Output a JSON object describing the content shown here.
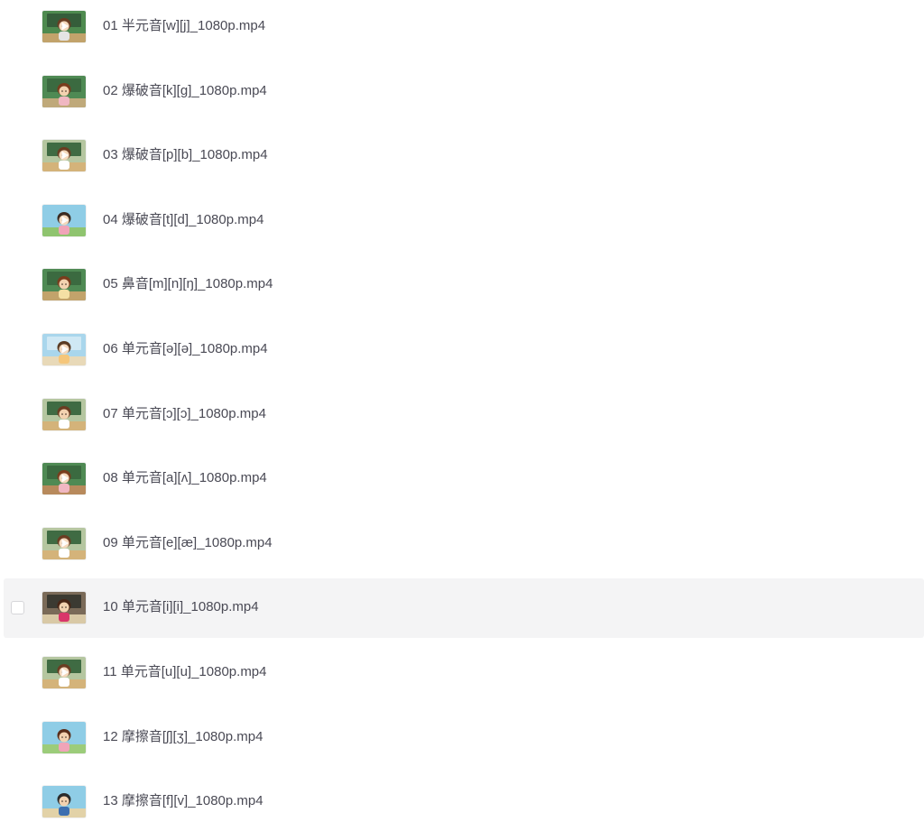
{
  "files": [
    {
      "name": "01 半元音[w][j]_1080p.mp4",
      "thumb": {
        "bg": "#4e8a4f",
        "board": "#355d3a",
        "floor": "#c2a36b",
        "face": "#f3d2b0",
        "hair": "#6b3d22",
        "shirt": "#e4e4e4",
        "play": true
      }
    },
    {
      "name": "02 爆破音[k][g]_1080p.mp4",
      "thumb": {
        "bg": "#4f8a54",
        "board": "#3b6a40",
        "floor": "#bfa97a",
        "face": "#f3d2b0",
        "hair": "#7a3d1d",
        "shirt": "#f0b7c2",
        "play": false
      }
    },
    {
      "name": "03 爆破音[p][b]_1080p.mp4",
      "thumb": {
        "bg": "#b5c6a0",
        "board": "#3f6b43",
        "floor": "#d4b37a",
        "face": "#f3d2b0",
        "hair": "#6b3d22",
        "shirt": "#ffffff",
        "play": true
      }
    },
    {
      "name": "04 爆破音[t][d]_1080p.mp4",
      "thumb": {
        "bg": "#8fcde6",
        "board": "#8fcde6",
        "floor": "#8fc46f",
        "face": "#f3d2b0",
        "hair": "#3b2a20",
        "shirt": "#f0a4b8",
        "play": true
      }
    },
    {
      "name": "05 鼻音[m][n][ŋ]_1080p.mp4",
      "thumb": {
        "bg": "#4f8a54",
        "board": "#3b6a40",
        "floor": "#c2a36b",
        "face": "#f3d2b0",
        "hair": "#7a3d1d",
        "shirt": "#f4e0a4",
        "play": false
      }
    },
    {
      "name": "06 单元音[ə][ə]_1080p.mp4",
      "thumb": {
        "bg": "#a9d6ec",
        "board": "#cfe8f4",
        "floor": "#e8d9b8",
        "face": "#f3d2b0",
        "hair": "#5a3a22",
        "shirt": "#f5c67a",
        "play": true
      }
    },
    {
      "name": "07 单元音[ɔ][ɔ]_1080p.mp4",
      "thumb": {
        "bg": "#b5c6a0",
        "board": "#3f6b43",
        "floor": "#d4b37a",
        "face": "#f3d2b0",
        "hair": "#6b3d22",
        "shirt": "#ffffff",
        "play": false
      }
    },
    {
      "name": "08 单元音[a][ʌ]_1080p.mp4",
      "thumb": {
        "bg": "#4f8a54",
        "board": "#3b6a40",
        "floor": "#b88a5c",
        "face": "#f3d2b0",
        "hair": "#7a3d1d",
        "shirt": "#f0b7c2",
        "play": true
      }
    },
    {
      "name": "09 单元音[e][æ]_1080p.mp4",
      "thumb": {
        "bg": "#b5c6a0",
        "board": "#3f6b43",
        "floor": "#d4b37a",
        "face": "#f3d2b0",
        "hair": "#6b3d22",
        "shirt": "#ffffff",
        "play": true
      }
    },
    {
      "name": "10 单元音[i][i]_1080p.mp4",
      "thumb": {
        "bg": "#7a6a58",
        "board": "#3b3a32",
        "floor": "#d9c9a6",
        "face": "#f3d2b0",
        "hair": "#4a2616",
        "shirt": "#d9366a",
        "play": false
      },
      "hover": true
    },
    {
      "name": "11 单元音[u][u]_1080p.mp4",
      "thumb": {
        "bg": "#b5c6a0",
        "board": "#3f6b43",
        "floor": "#d4b37a",
        "face": "#f3d2b0",
        "hair": "#6b3d22",
        "shirt": "#ffffff",
        "play": true
      }
    },
    {
      "name": "12 摩擦音[ʃ][ʒ]_1080p.mp4",
      "thumb": {
        "bg": "#8fcde6",
        "board": "#8fcde6",
        "floor": "#9ccc7a",
        "face": "#f3d2b0",
        "hair": "#5a2e1a",
        "shirt": "#f0a4b8",
        "play": false
      }
    },
    {
      "name": "13 摩擦音[f][v]_1080p.mp4",
      "thumb": {
        "bg": "#8fcde6",
        "board": "#8fcde6",
        "floor": "#e2d2a8",
        "face": "#f3d2b0",
        "hair": "#2b2b2b",
        "shirt": "#3d6fb0",
        "play": false
      }
    }
  ]
}
